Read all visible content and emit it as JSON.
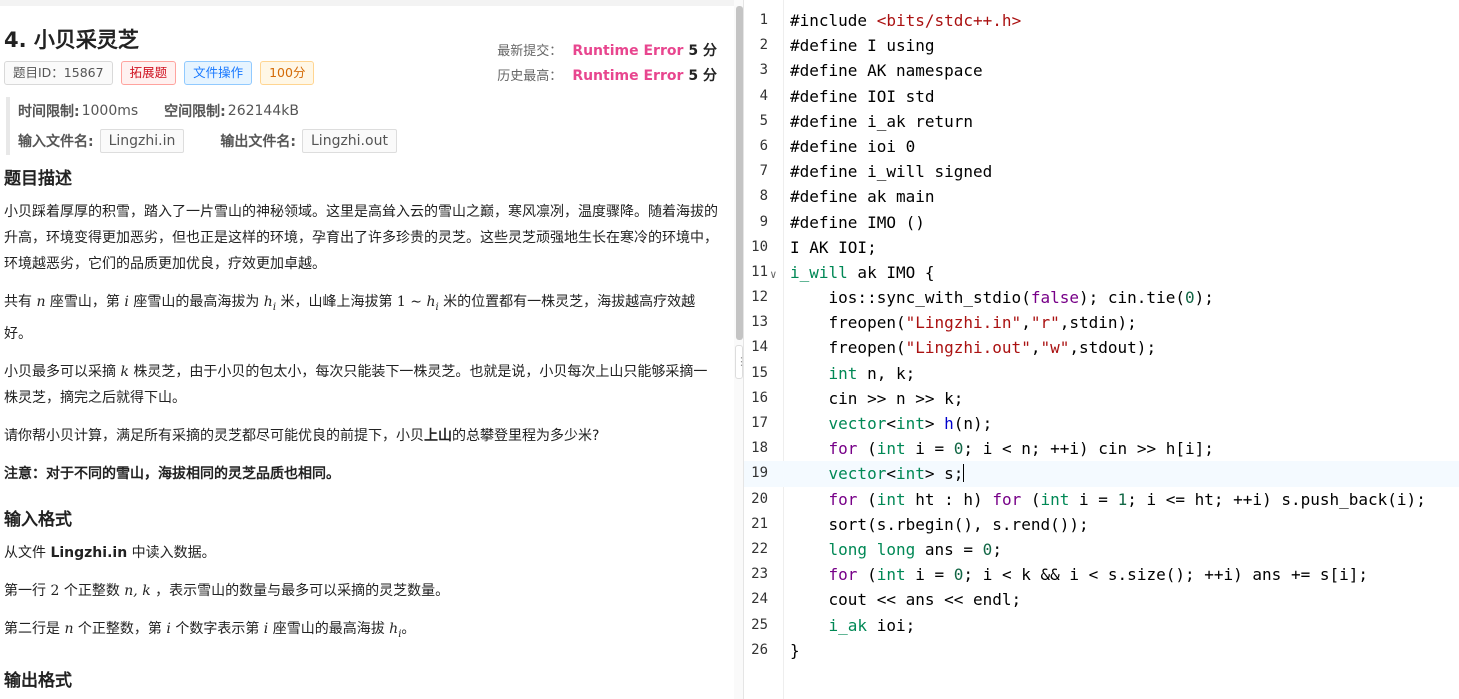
{
  "problem": {
    "title": "4.  小贝采灵芝",
    "tags": {
      "id": "题目ID：15867",
      "ext": "拓展题",
      "file": "文件操作",
      "score": "100分"
    },
    "latest_label": "最新提交：",
    "latest_result": "Runtime Error",
    "latest_score": "5 分",
    "best_label": "历史最高：",
    "best_result": "Runtime Error",
    "best_score": "5 分",
    "time_label": "时间限制:",
    "time_value": "1000ms",
    "mem_label": "空间限制:",
    "mem_value": "262144kB",
    "input_file_label": "输入文件名:",
    "input_file": "Lingzhi.in",
    "output_file_label": "输出文件名:",
    "output_file": "Lingzhi.out"
  },
  "desc": {
    "heading": "题目描述",
    "p1": "小贝踩着厚厚的积雪，踏入了一片雪山的神秘领域。这里是高耸入云的雪山之巅，寒风凛冽，温度骤降。随着海拔的升高，环境变得更加恶劣，但也正是这样的环境，孕育出了许多珍贵的灵芝。这些灵芝顽强地生长在寒冷的环境中，环境越恶劣，它们的品质更加优良，疗效更加卓越。",
    "p2a": "共有 ",
    "p2n": "n",
    "p2b": " 座雪山，第 ",
    "p2i": "i",
    "p2c": " 座雪山的最高海拔为 ",
    "p2h": "h",
    "p2sub": "i",
    "p2d": " 米，山峰上海拔第 ",
    "p2one": "1 ∼ ",
    "p2h2": "h",
    "p2sub2": "i",
    "p2e": " 米的位置都有一株灵芝，海拔越高疗效越好。",
    "p3a": "小贝最多可以采摘 ",
    "p3k": "k",
    "p3b": " 株灵芝，由于小贝的包太小，每次只能装下一株灵芝。也就是说，小贝每次上山只能够采摘一株灵芝，摘完之后就得下山。",
    "p4a": "请你帮小贝计算，满足所有采摘的灵芝都尽可能优良的前提下，小贝",
    "p4b": "上山",
    "p4c": "的总攀登里程为多少米?",
    "p5": "注意：对于不同的雪山，海拔相同的灵芝品质也相同。"
  },
  "input": {
    "heading": "输入格式",
    "p1a": "从文件 ",
    "p1b": "Lingzhi.in",
    "p1c": " 中读入数据。",
    "p2a": "第一行 ",
    "p2two": "2",
    "p2b": " 个正整数 ",
    "p2nk": "n, k",
    "p2c": " ，表示雪山的数量与最多可以采摘的灵芝数量。",
    "p3a": "第二行是 ",
    "p3n": "n",
    "p3b": " 个正整数，第 ",
    "p3i": "i",
    "p3c": " 个数字表示第 ",
    "p3i2": "i",
    "p3d": " 座雪山的最高海拔 ",
    "p3h": "h",
    "p3sub": "i",
    "p3e": "。"
  },
  "output": {
    "heading": "输出格式"
  },
  "editor": {
    "line_numbers": [
      "1",
      "2",
      "3",
      "4",
      "5",
      "6",
      "7",
      "8",
      "9",
      "10",
      "11",
      "12",
      "13",
      "14",
      "15",
      "16",
      "17",
      "18",
      "19",
      "20",
      "21",
      "22",
      "23",
      "24",
      "25",
      "26"
    ],
    "fold_marker": "∨",
    "grip": "⋮"
  }
}
